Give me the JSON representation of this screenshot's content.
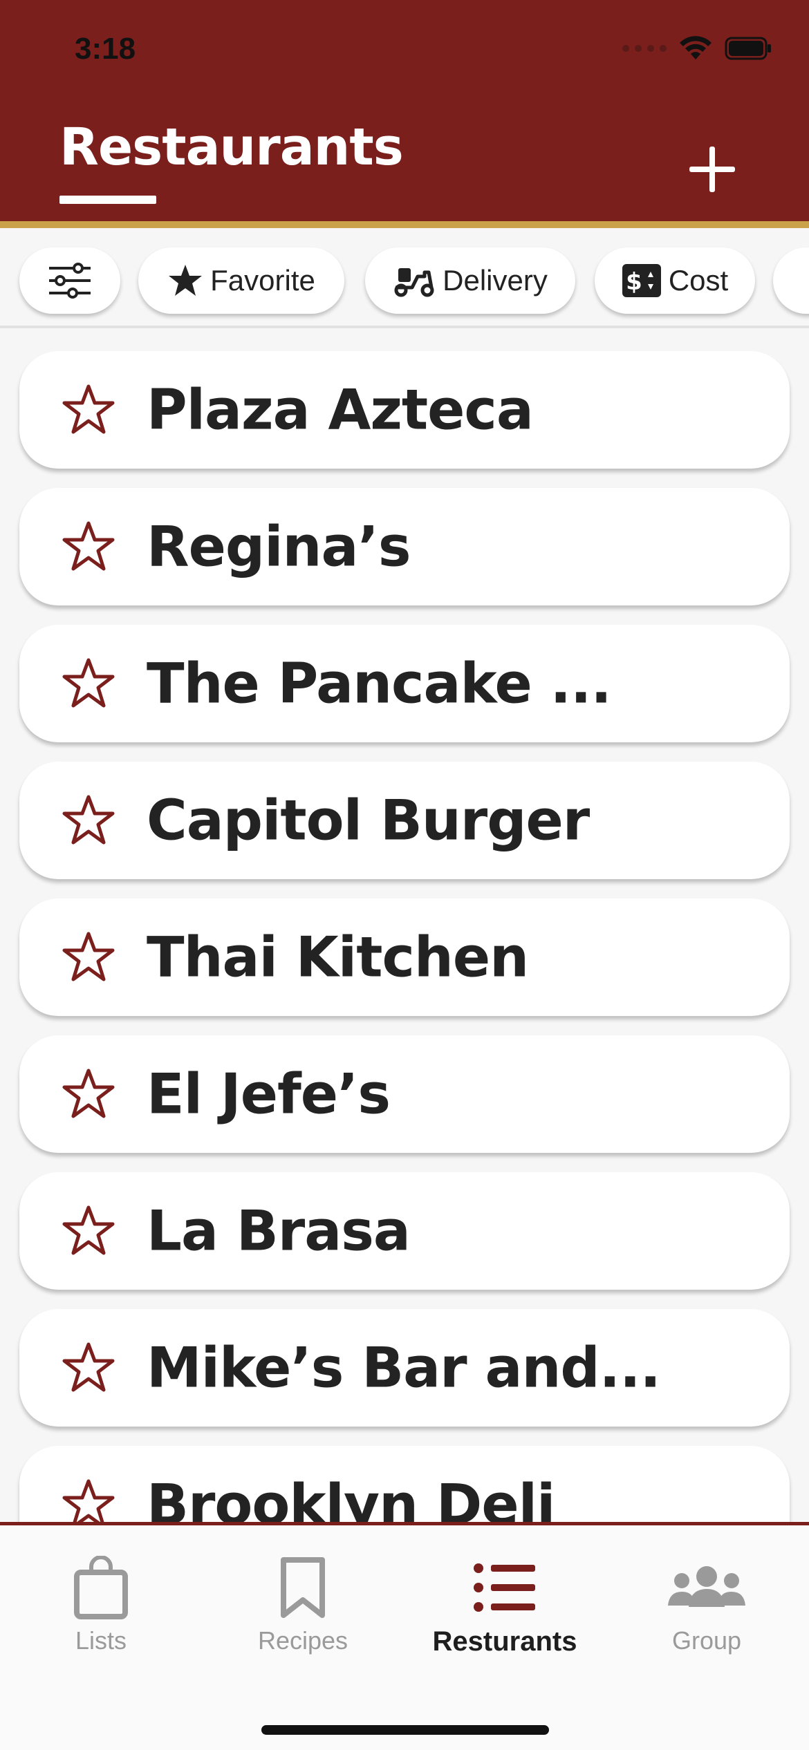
{
  "status_bar": {
    "time": "3:18"
  },
  "header": {
    "title": "Restaurants",
    "add_icon": "plus-icon"
  },
  "colors": {
    "brand": "#7a1f1c",
    "accent": "#c9a24a",
    "star_outline": "#7a1f1c"
  },
  "filters": [
    {
      "icon": "sliders-icon",
      "label": ""
    },
    {
      "icon": "star-filled-icon",
      "label": "Favorite"
    },
    {
      "icon": "scooter-icon",
      "label": "Delivery"
    },
    {
      "icon": "dollar-sort-icon",
      "label": "Cost"
    }
  ],
  "restaurants": [
    {
      "name": "Plaza Azteca",
      "favorite": false
    },
    {
      "name": "Regina’s",
      "favorite": false
    },
    {
      "name": "The Pancake ...",
      "favorite": false
    },
    {
      "name": "Capitol Burger",
      "favorite": false
    },
    {
      "name": "Thai Kitchen",
      "favorite": false
    },
    {
      "name": "El Jefe’s",
      "favorite": false
    },
    {
      "name": "La Brasa",
      "favorite": false
    },
    {
      "name": "Mike’s Bar and...",
      "favorite": false
    },
    {
      "name": "Brooklyn Deli",
      "favorite": false
    }
  ],
  "tabs": [
    {
      "label": "Lists",
      "icon": "shopping-bag-icon",
      "active": false
    },
    {
      "label": "Recipes",
      "icon": "bookmark-icon",
      "active": false
    },
    {
      "label": "Resturants",
      "icon": "list-icon",
      "active": true
    },
    {
      "label": "Group",
      "icon": "group-icon",
      "active": false
    }
  ]
}
